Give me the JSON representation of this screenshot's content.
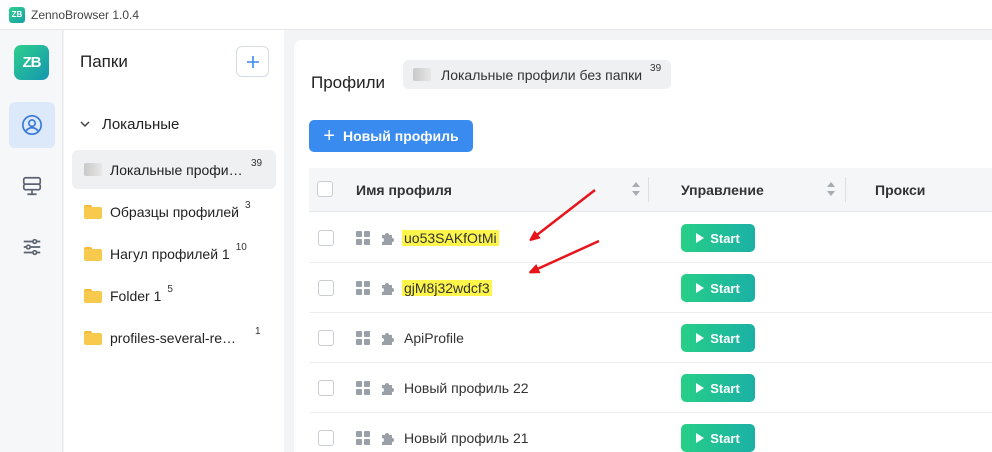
{
  "window": {
    "title": "ZennoBrowser 1.0.4",
    "logo_text": "ZB"
  },
  "rail": {
    "logo_text": "ZB",
    "items": [
      {
        "icon": "profile-icon",
        "active": true
      },
      {
        "icon": "server-icon",
        "active": false
      },
      {
        "icon": "sliders-icon",
        "active": false
      }
    ]
  },
  "folders": {
    "title": "Папки",
    "add_icon": "plus-icon",
    "group_label": "Локальные",
    "items": [
      {
        "name": "Локальные профили без папки",
        "count": "39",
        "icon": "gray-folder-icon",
        "active": true
      },
      {
        "name": "Образцы профилей",
        "count": "3",
        "icon": "folder-icon"
      },
      {
        "name": "Нагул профилей 1",
        "count": "10",
        "icon": "folder-icon"
      },
      {
        "name": "Folder 1",
        "count": "5",
        "icon": "folder-icon"
      },
      {
        "name": "profiles-several-requests",
        "count": "1",
        "icon": "folder-icon"
      }
    ]
  },
  "main": {
    "title": "Профили",
    "chip": {
      "label": "Локальные профили без папки",
      "count": "39"
    },
    "new_profile_label": "Новый профиль",
    "columns": {
      "name": "Имя профиля",
      "control": "Управление",
      "proxy": "Прокси"
    },
    "start_label": "Start",
    "rows": [
      {
        "name": "uo53SAKfOtMi",
        "highlighted": true
      },
      {
        "name": "gjM8j32wdcf3",
        "highlighted": true
      },
      {
        "name": "ApiProfile",
        "highlighted": false
      },
      {
        "name": "Новый профиль 22",
        "highlighted": false
      },
      {
        "name": "Новый профиль 21",
        "highlighted": false
      }
    ]
  },
  "colors": {
    "accent": "#3a8bf0",
    "start_green": "#27cf87",
    "highlight": "#fdf54a",
    "arrow": "#e8141b"
  }
}
